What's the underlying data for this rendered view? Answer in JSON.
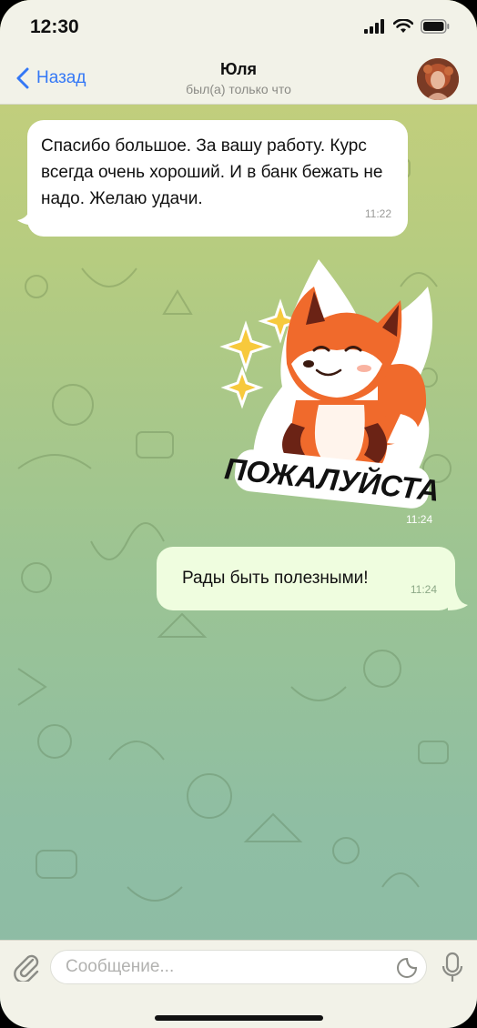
{
  "status_bar": {
    "time": "12:30"
  },
  "header": {
    "back_label": "Назад",
    "title": "Юля",
    "subtitle": "был(а) только что"
  },
  "messages": [
    {
      "direction": "incoming",
      "text": "Спасибо большое. За вашу работу. Курс всегда очень хороший. И в банк бежать не надо. Желаю удачи.",
      "time": "11:22"
    },
    {
      "direction": "outgoing",
      "type": "sticker",
      "sticker_text": "ПОЖАЛУЙСТА",
      "time": "11:24"
    },
    {
      "direction": "outgoing",
      "text": "Рады быть полезными!",
      "time": "11:24"
    }
  ],
  "composer": {
    "placeholder": "Сообщение..."
  },
  "colors": {
    "accent": "#3478f6",
    "incoming_bubble": "#ffffff",
    "outgoing_bubble": "#effddf",
    "bars": "#f2f2e8"
  },
  "icons": [
    "signal-icon",
    "wifi-icon",
    "battery-icon",
    "back-chevron-icon",
    "paperclip-icon",
    "sticker-icon",
    "microphone-icon"
  ]
}
